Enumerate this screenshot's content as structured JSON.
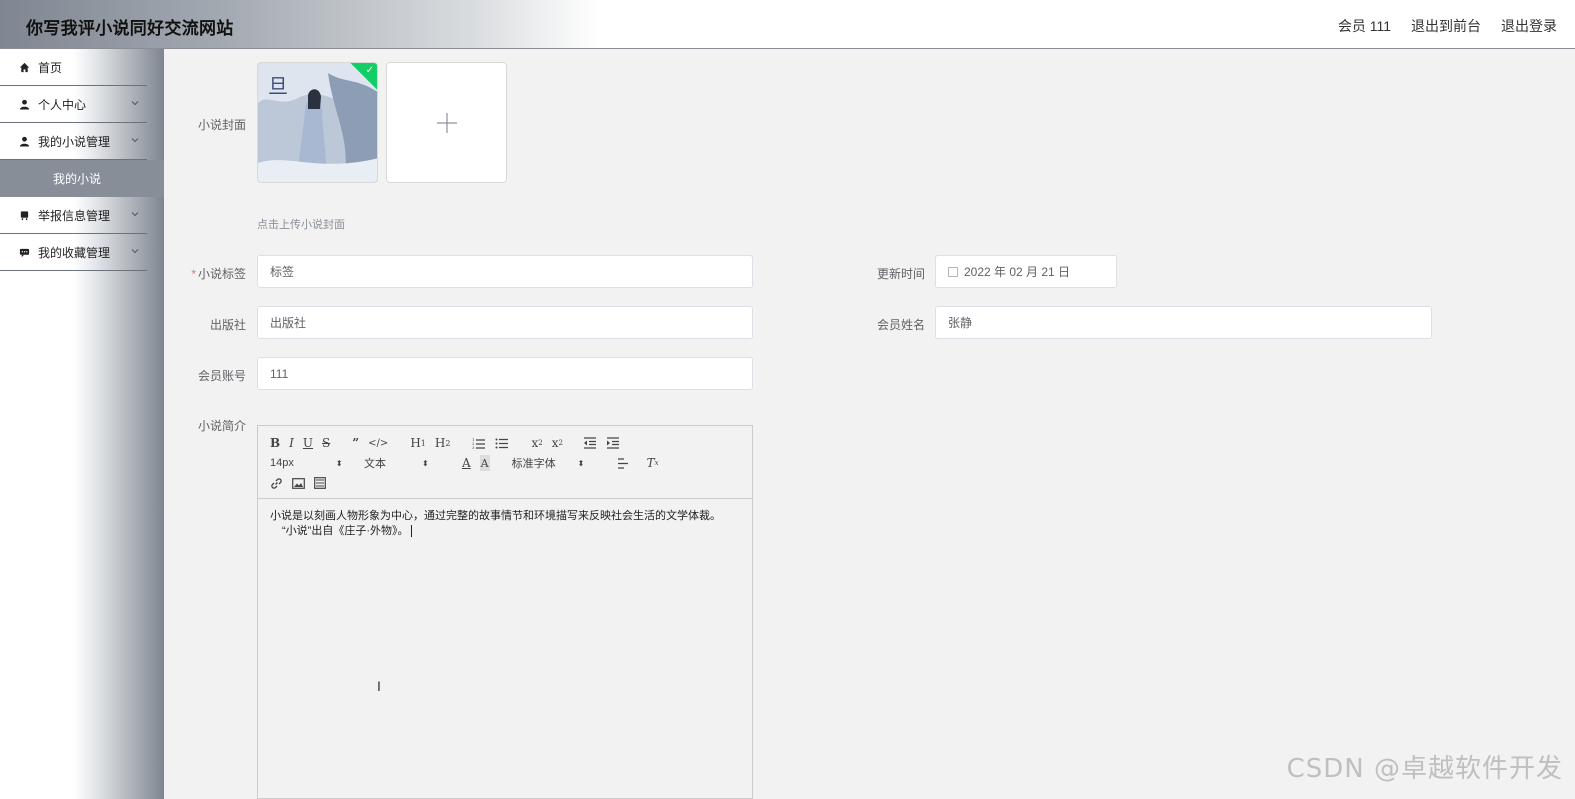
{
  "header": {
    "title": "你写我评小说同好交流网站",
    "member": "会员 111",
    "to_front": "退出到前台",
    "logout": "退出登录"
  },
  "sidebar": {
    "items": [
      {
        "label": "首页",
        "icon": "home-icon"
      },
      {
        "label": "个人中心",
        "icon": "user-icon"
      },
      {
        "label": "我的小说管理",
        "icon": "user-icon"
      },
      {
        "label": "举报信息管理",
        "icon": "report-icon"
      },
      {
        "label": "我的收藏管理",
        "icon": "chat-icon"
      }
    ],
    "active_sub": "我的小说"
  },
  "form": {
    "cover_label": "小说封面",
    "upload_tip": "点击上传小说封面",
    "tag_label": "小说标签",
    "tag_value": "标签",
    "update_label": "更新时间",
    "update_value": "2022 年 02 月 21 日",
    "publisher_label": "出版社",
    "publisher_value": "出版社",
    "member_name_label": "会员姓名",
    "member_name_value": "张静",
    "member_account_label": "会员账号",
    "member_account_value": "111",
    "intro_label": "小说简介"
  },
  "editor": {
    "font_size": "14px",
    "text_type": "文本",
    "font_family": "标准字体",
    "content_line1": "小说是以刻画人物形象为中心，通过完整的故事情节和环境描写来反映社会生活的文学体裁。",
    "content_line2": "“小说”出自《庄子·外物》。"
  },
  "watermark": "CSDN @卓越软件开发"
}
